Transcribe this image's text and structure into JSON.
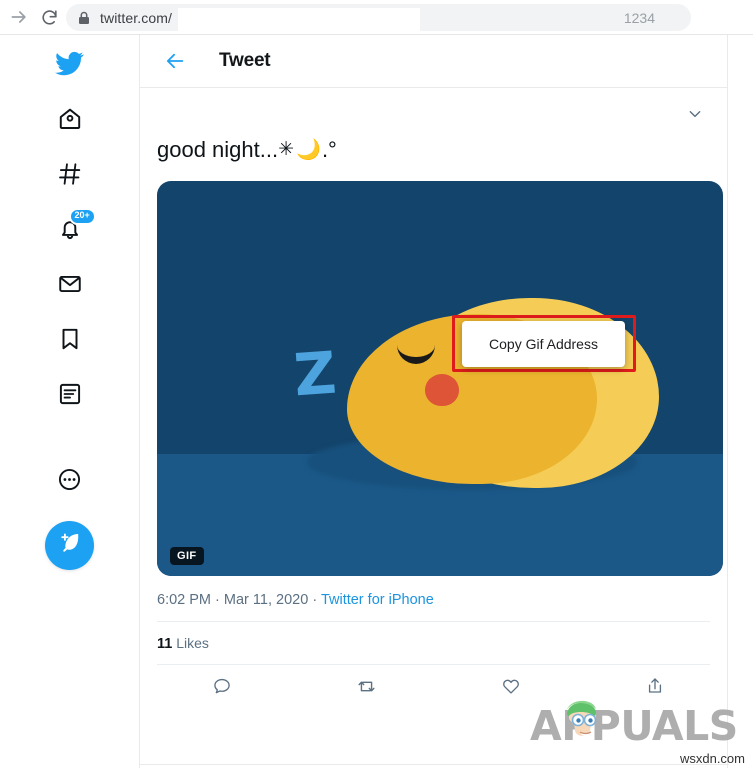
{
  "browser": {
    "forward_icon": "forward-arrow-icon",
    "reload_icon": "reload-icon",
    "lock_icon": "lock-icon",
    "url": "twitter.com/",
    "url_suffix": "",
    "omnibox_right_text": "1234"
  },
  "sidebar": {
    "items": [
      {
        "name": "twitter-logo",
        "icon": "twitter-bird-icon",
        "label": "Twitter"
      },
      {
        "name": "home",
        "icon": "home-icon",
        "label": "Home"
      },
      {
        "name": "explore",
        "icon": "hashtag-icon",
        "label": "Explore"
      },
      {
        "name": "notifications",
        "icon": "bell-icon",
        "label": "Notifications",
        "badge": "20+"
      },
      {
        "name": "messages",
        "icon": "envelope-icon",
        "label": "Messages"
      },
      {
        "name": "bookmarks",
        "icon": "bookmark-icon",
        "label": "Bookmarks"
      },
      {
        "name": "lists",
        "icon": "list-icon",
        "label": "Lists"
      },
      {
        "name": "more",
        "icon": "more-dots-icon",
        "label": "More"
      }
    ],
    "compose": {
      "icon": "feather-plus-icon",
      "label": "Tweet"
    }
  },
  "header": {
    "back_icon": "back-arrow-icon",
    "title": "Tweet"
  },
  "tweet": {
    "caret_icon": "chevron-down-icon",
    "text": "good night...",
    "emoji_star": "✳",
    "emoji_moon": "🌙",
    "text_tail": ".°",
    "media": {
      "type": "gif",
      "badge": "GIF",
      "alt": "sleeping yellow blob character with Z",
      "zzz": "Z",
      "bg_color": "#13446b",
      "floor_color": "#1b5888",
      "blob_color": "#ecb42e",
      "blob_light_color": "#f5cd56",
      "mouth_color": "#de5436",
      "z_color": "#4da3dd"
    },
    "timestamp": "6:02 PM",
    "date": "Mar 11, 2020",
    "source": "Twitter for iPhone",
    "separator": "·",
    "likes_count": "11",
    "likes_label": "Likes",
    "actions": [
      {
        "name": "reply",
        "icon": "comment-icon"
      },
      {
        "name": "retweet",
        "icon": "retweet-icon"
      },
      {
        "name": "like",
        "icon": "heart-icon"
      },
      {
        "name": "share",
        "icon": "share-up-arrow-icon"
      }
    ]
  },
  "context_menu": {
    "items": [
      "Copy Gif Address"
    ],
    "highlight_color": "#e01b1b"
  },
  "watermark": {
    "brand": "APPUALS",
    "site": "wsxdn.com"
  }
}
